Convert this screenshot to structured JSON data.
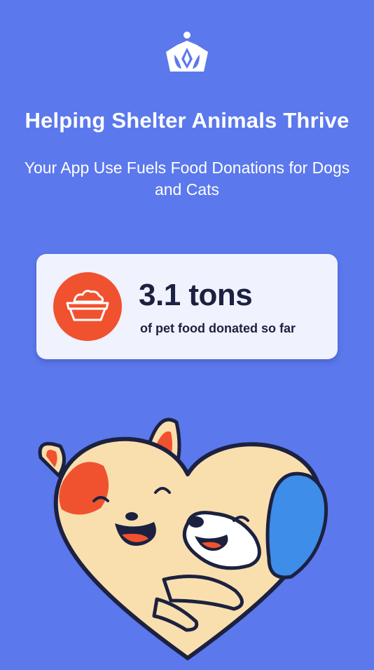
{
  "header": {
    "logo_icon": "crown-icon",
    "title": "Helping Shelter Animals Thrive",
    "subtitle": "Your App Use Fuels Food Donations for Dogs and Cats"
  },
  "stat": {
    "icon": "pet-food-bowl-icon",
    "value": "3.1 tons",
    "caption": "of pet food donated so far"
  },
  "illustration": {
    "icon": "cat-and-dog-hugging-heart-illustration"
  },
  "colors": {
    "background": "#5b78ec",
    "card": "#f0f2fd",
    "accent": "#f0522f",
    "text_dark": "#1c2140"
  }
}
